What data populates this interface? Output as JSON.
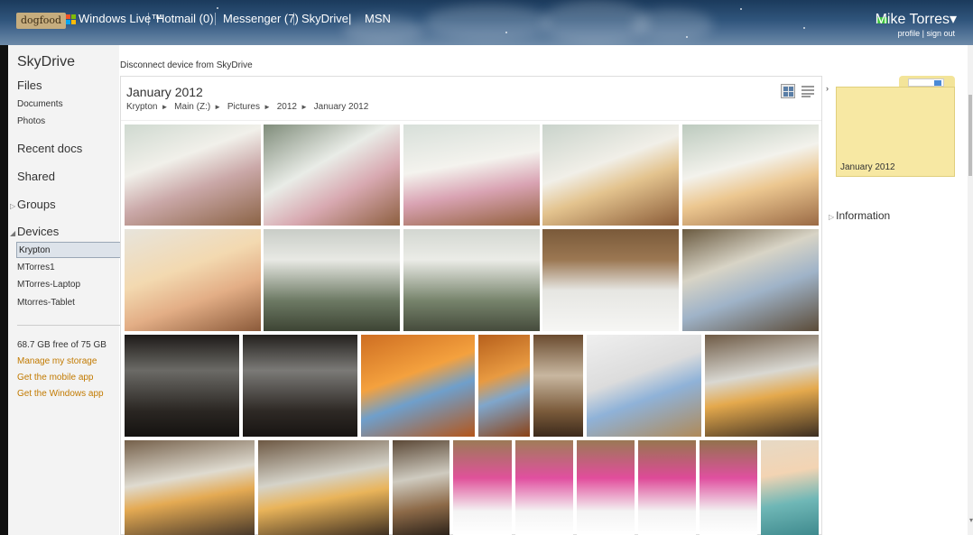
{
  "topbar": {
    "badge": "dogfood",
    "brand": "Windows Live™",
    "hotmail": "Hotmail (0)",
    "messenger": "Messenger (7)",
    "skydrive": "SkyDrive",
    "msn": "MSN",
    "user_name": "Mike Torres▾",
    "profile_link": "profile",
    "link_separator": "|",
    "sign_out_link": "sign out",
    "nav_separator": "|"
  },
  "sidebar": {
    "title": "SkyDrive",
    "files": "Files",
    "documents": "Documents",
    "photos": "Photos",
    "recent_docs": "Recent docs",
    "shared": "Shared",
    "groups": "Groups",
    "devices": "Devices",
    "device_items": [
      "Krypton",
      "MTorres1",
      "MTorres-Laptop",
      "Mtorres-Tablet"
    ],
    "storage": "68.7 GB free of 75 GB",
    "manage_storage": "Manage my storage",
    "mobile_app": "Get the mobile app",
    "windows_app": "Get the Windows app"
  },
  "main": {
    "disconnect": "Disconnect device from SkyDrive",
    "folder_title": "January 2012",
    "breadcrumb": [
      "Krypton",
      "Main (Z:)",
      "Pictures",
      "2012",
      "January 2012"
    ],
    "breadcrumb_arrow": "►",
    "photo_count": 26
  },
  "details_pane": {
    "folder_name": "January 2012",
    "information": "Information",
    "expand_glyph": "›",
    "collapsed_glyph": "▷"
  },
  "icons": [
    "windows-flag-icon",
    "status-online-icon",
    "thumbnail-view-icon",
    "list-view-icon",
    "folder-icon"
  ],
  "colors": {
    "link_orange": "#c27a00",
    "selected_bg": "#dde3ea",
    "folder_yellow": "#f7e8a3",
    "topbar": "#30557c"
  }
}
